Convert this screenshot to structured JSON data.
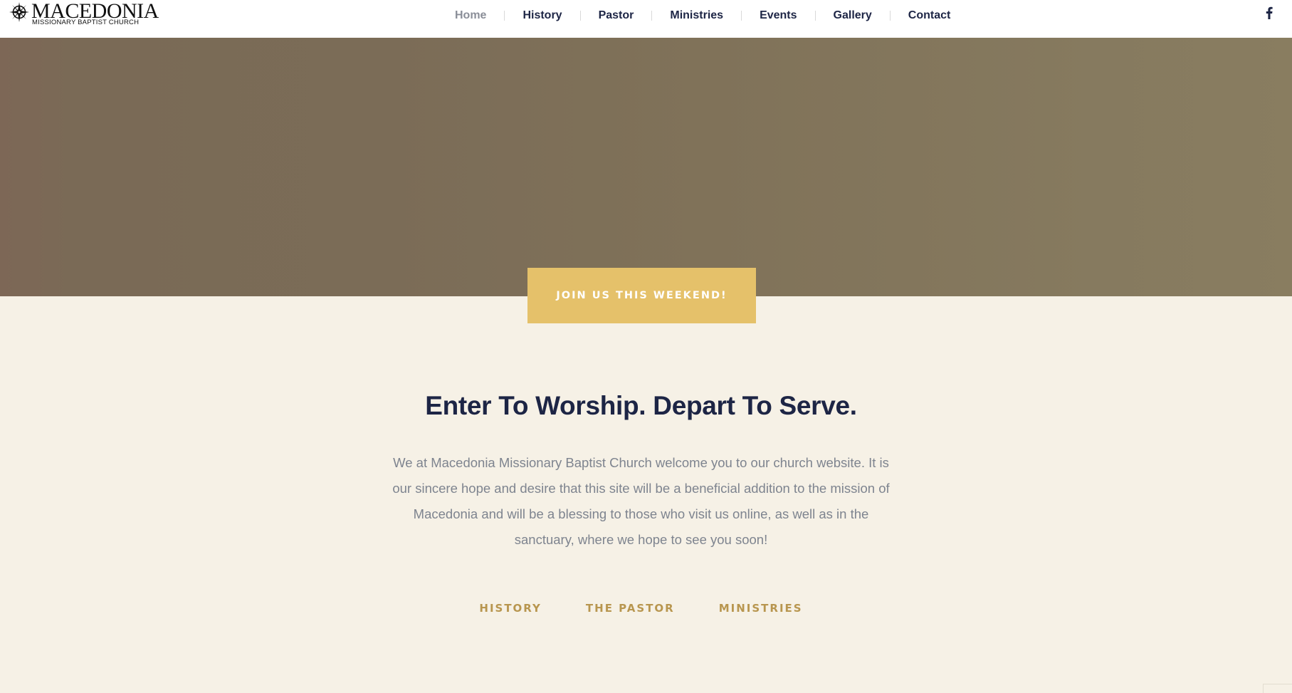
{
  "header": {
    "logo": {
      "name": "MACEDONIA",
      "subtitle": "MISSIONARY BAPTIST CHURCH"
    },
    "nav": [
      {
        "label": "Home",
        "active": true
      },
      {
        "label": "History",
        "active": false
      },
      {
        "label": "Pastor",
        "active": false
      },
      {
        "label": "Ministries",
        "active": false
      },
      {
        "label": "Events",
        "active": false
      },
      {
        "label": "Gallery",
        "active": false
      },
      {
        "label": "Contact",
        "active": false
      }
    ],
    "social_icon": "facebook-icon"
  },
  "hero": {
    "cta_label": "JOIN US THIS WEEKEND!"
  },
  "content": {
    "title": "Enter To Worship. Depart To Serve.",
    "body": "We at Macedonia Missionary Baptist Church welcome you to our church website. It is our sincere hope and desire that this site will be a beneficial addition to the mission of Macedonia and will be a blessing to those who visit us online, as well as in the sanctuary, where we hope to see you soon!",
    "links": [
      "HISTORY",
      "THE PASTOR",
      "MINISTRIES"
    ]
  },
  "colors": {
    "navy": "#1d2545",
    "gold": "#e5c16a",
    "link_gold": "#b8964f",
    "cream": "#f6f1e6"
  }
}
